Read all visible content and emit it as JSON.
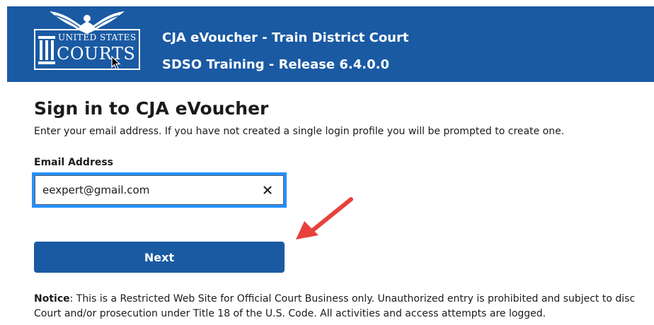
{
  "header": {
    "logo": {
      "line1": "UNITED STATES",
      "line2": "COURTS"
    },
    "title": "CJA eVoucher - Train District Court",
    "subtitle": "SDSO Training - Release 6.4.0.0",
    "background_color": "#1a5aa3"
  },
  "main": {
    "title": "Sign in to CJA eVoucher",
    "intro": "Enter your email address. If you have not created a single login profile you will be prompted to create one.",
    "email": {
      "label": "Email Address",
      "value": "eexpert@gmail.com",
      "clear_icon": "close-icon",
      "focus_color": "#2491ff"
    },
    "next_label": "Next",
    "annotation_arrow_color": "#e8413c",
    "notice": {
      "label": "Notice",
      "line1": ": This is a Restricted Web Site for Official Court Business only. Unauthorized entry is prohibited and subject to disc",
      "line2": "Court and/or prosecution under Title 18 of the U.S. Code. All activities and access attempts are logged."
    }
  }
}
